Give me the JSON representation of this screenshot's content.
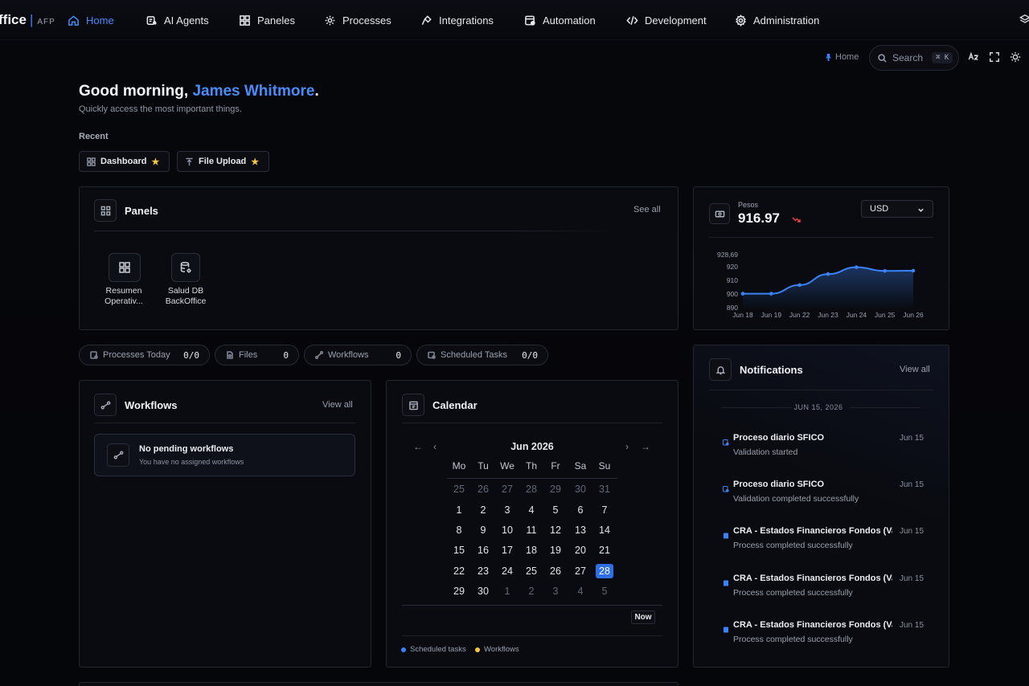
{
  "nav": {
    "brand": "ffice",
    "brand_sep": "|",
    "brand_sub": "AFP",
    "items": [
      {
        "label": "Home",
        "icon": "home-icon",
        "active": true
      },
      {
        "label": "AI Agents",
        "icon": "ai-agents-icon"
      },
      {
        "label": "Paneles",
        "icon": "grid-icon"
      },
      {
        "label": "Processes",
        "icon": "gear-icon"
      },
      {
        "label": "Integrations",
        "icon": "plug-icon"
      },
      {
        "label": "Automation",
        "icon": "automation-icon"
      },
      {
        "label": "Development",
        "icon": "code-icon"
      },
      {
        "label": "Administration",
        "icon": "settings-icon"
      }
    ]
  },
  "toolbar": {
    "breadcrumb": "Home",
    "search_label": "Search",
    "search_shortcut": "⌘ K",
    "icons": [
      "translate-icon",
      "fullscreen-icon",
      "sun-icon"
    ]
  },
  "greeting": {
    "prefix": "Good morning, ",
    "name": "James Whitmore",
    "suffix": ".",
    "subtitle": "Quickly access the most important things."
  },
  "recent": {
    "label": "Recent",
    "items": [
      {
        "label": "Dashboard",
        "icon": "dashboard-icon",
        "starred": true
      },
      {
        "label": "File Upload",
        "icon": "upload-icon",
        "starred": true
      }
    ]
  },
  "panels": {
    "title": "Panels",
    "see_all": "See all",
    "items": [
      {
        "label_line1": "Resumen",
        "label_line2": "Operativ...",
        "icon": "dashboard-icon"
      },
      {
        "label_line1": "Salud DB",
        "label_line2": "BackOffice",
        "icon": "database-settings-icon"
      }
    ]
  },
  "stats": [
    {
      "label": "Processes Today",
      "value": "0/0",
      "icon": "process-icon"
    },
    {
      "label": "Files",
      "value": "0",
      "icon": "file-icon"
    },
    {
      "label": "Workflows",
      "value": "0",
      "icon": "workflow-icon"
    },
    {
      "label": "Scheduled Tasks",
      "value": "0/0",
      "icon": "scheduled-icon"
    }
  ],
  "workflows": {
    "title": "Workflows",
    "view_all": "View all",
    "empty_title": "No pending workflows",
    "empty_sub": "You have no assigned workflows"
  },
  "calendar": {
    "title": "Calendar",
    "month": "Jun 2026",
    "weekdays": [
      "Mo",
      "Tu",
      "We",
      "Th",
      "Fr",
      "Sa",
      "Su"
    ],
    "weeks": [
      [
        "25",
        "26",
        "27",
        "28",
        "29",
        "30",
        "31"
      ],
      [
        "1",
        "2",
        "3",
        "4",
        "5",
        "6",
        "7"
      ],
      [
        "8",
        "9",
        "10",
        "11",
        "12",
        "13",
        "14"
      ],
      [
        "15",
        "16",
        "17",
        "18",
        "19",
        "20",
        "21"
      ],
      [
        "22",
        "23",
        "24",
        "25",
        "26",
        "27",
        "28"
      ],
      [
        "29",
        "30",
        "1",
        "2",
        "3",
        "4",
        "5"
      ]
    ],
    "muted_first_row": true,
    "muted_last_row_from": 2,
    "selected": "28",
    "now_label": "Now",
    "legend": [
      {
        "label": "Scheduled tasks",
        "color": "#3b82f6"
      },
      {
        "label": "Workflows",
        "color": "#f5c542"
      }
    ]
  },
  "currency": {
    "label": "Pesos",
    "value": "916.97",
    "trend": "down",
    "select_value": "USD"
  },
  "chart_data": {
    "type": "area",
    "title": "",
    "x": [
      "Jun 18",
      "Jun 19",
      "Jun 22",
      "Jun 23",
      "Jun 24",
      "Jun 25",
      "Jun 26"
    ],
    "series": [
      {
        "values": [
          900.2,
          900.2,
          906.5,
          914.5,
          919.5,
          916.8,
          916.97
        ]
      }
    ],
    "y_ticks": [
      "928,69",
      "920",
      "910",
      "900",
      "890"
    ],
    "ylim": [
      890,
      928.69
    ],
    "color": "#3b82f6",
    "grid": false
  },
  "notifications": {
    "title": "Notifications",
    "view_all": "View all",
    "date_label": "JUN 15, 2026",
    "items": [
      {
        "title": "Proceso diario SFICO",
        "subtitle": "Validation started",
        "date": "Jun 15",
        "icon": "process-icon"
      },
      {
        "title": "Proceso diario SFICO",
        "subtitle": "Validation completed successfully",
        "date": "Jun 15",
        "icon": "process-icon"
      },
      {
        "title": "CRA - Estados Financieros Fondos (Vali...",
        "subtitle": "Process completed successfully",
        "date": "Jun 15",
        "icon": "document-icon"
      },
      {
        "title": "CRA - Estados Financieros Fondos (Vali...",
        "subtitle": "Process completed successfully",
        "date": "Jun 15",
        "icon": "document-icon"
      },
      {
        "title": "CRA - Estados Financieros Fondos (Vali...",
        "subtitle": "Process completed successfully",
        "date": "Jun 15",
        "icon": "document-icon"
      }
    ]
  }
}
